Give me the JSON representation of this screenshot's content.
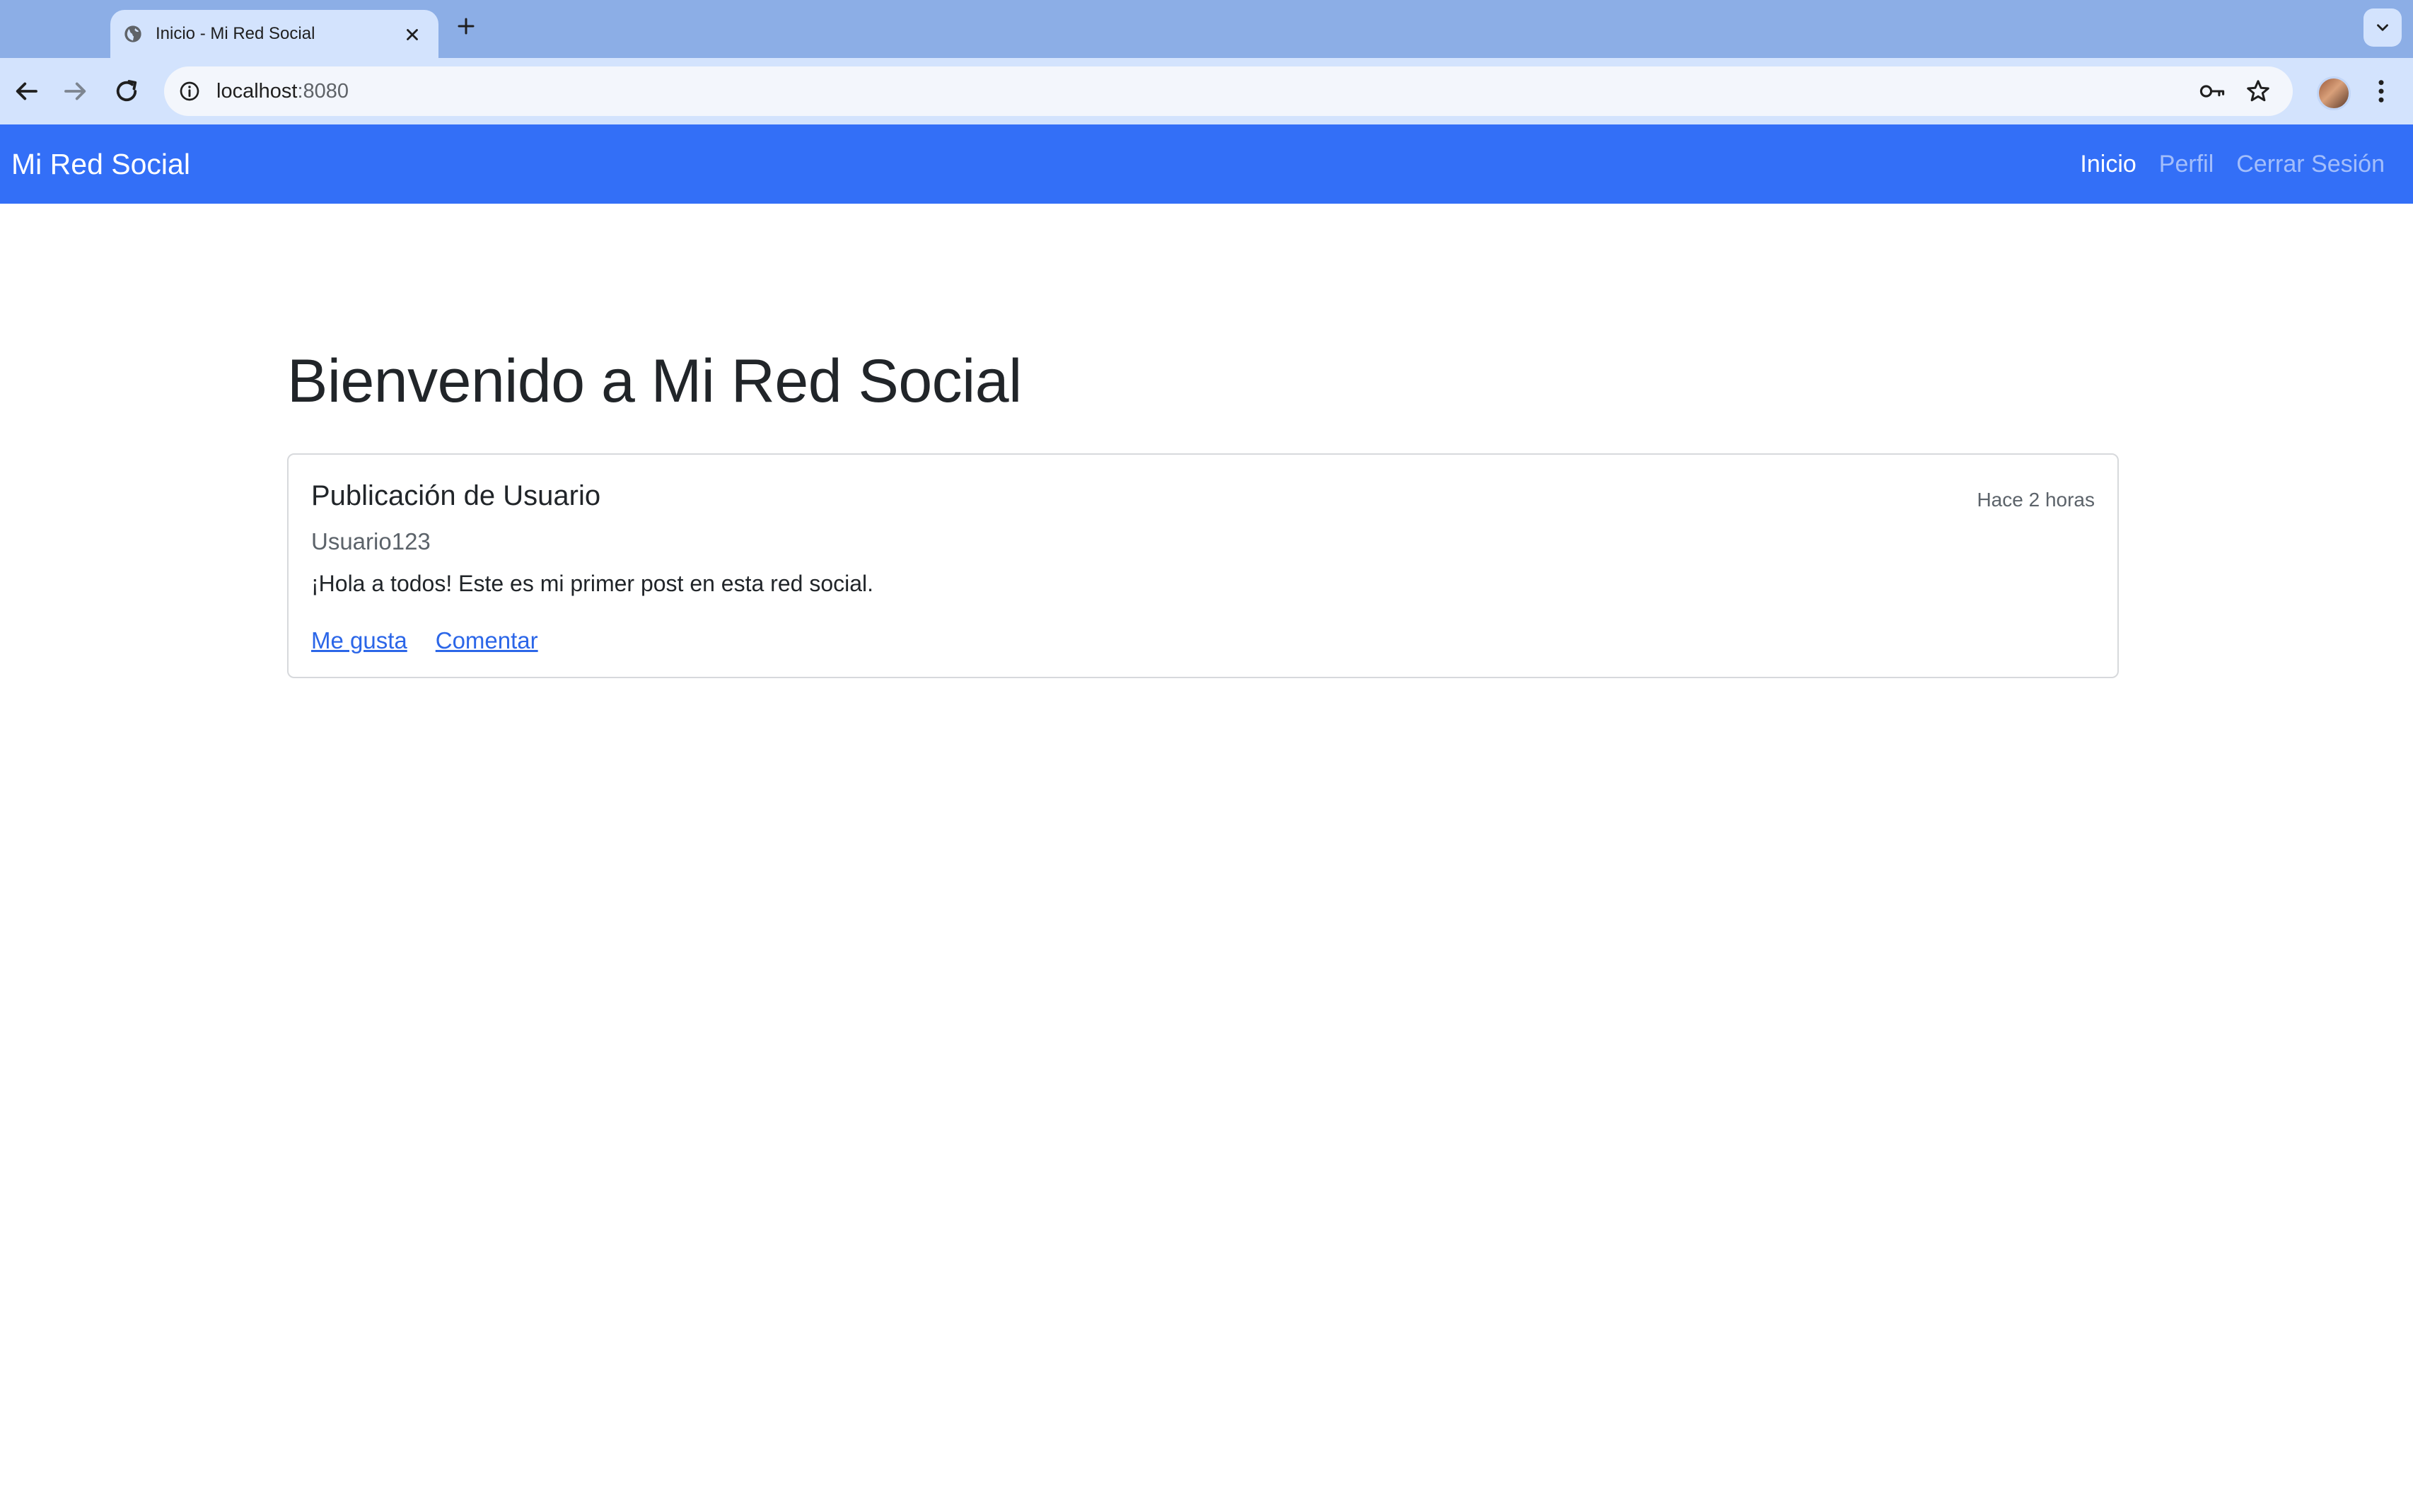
{
  "browser": {
    "tab_title": "Inicio - Mi Red Social",
    "url_host": "localhost",
    "url_port": ":8080"
  },
  "navbar": {
    "brand": "Mi Red Social",
    "links": [
      {
        "label": "Inicio"
      },
      {
        "label": "Perfil"
      },
      {
        "label": "Cerrar Sesión"
      }
    ]
  },
  "main": {
    "heading": "Bienvenido a Mi Red Social",
    "post": {
      "title": "Publicación de Usuario",
      "time": "Hace 2 horas",
      "author": "Usuario123",
      "body": "¡Hola a todos! Este es mi primer post en esta red social.",
      "actions": [
        {
          "label": "Me gusta"
        },
        {
          "label": "Comentar"
        }
      ]
    }
  },
  "colors": {
    "navbar_bg": "#336ff7",
    "tabstrip_bg": "#8caee6",
    "toolbar_bg": "#d3e3fd",
    "link": "#2b66e8"
  }
}
